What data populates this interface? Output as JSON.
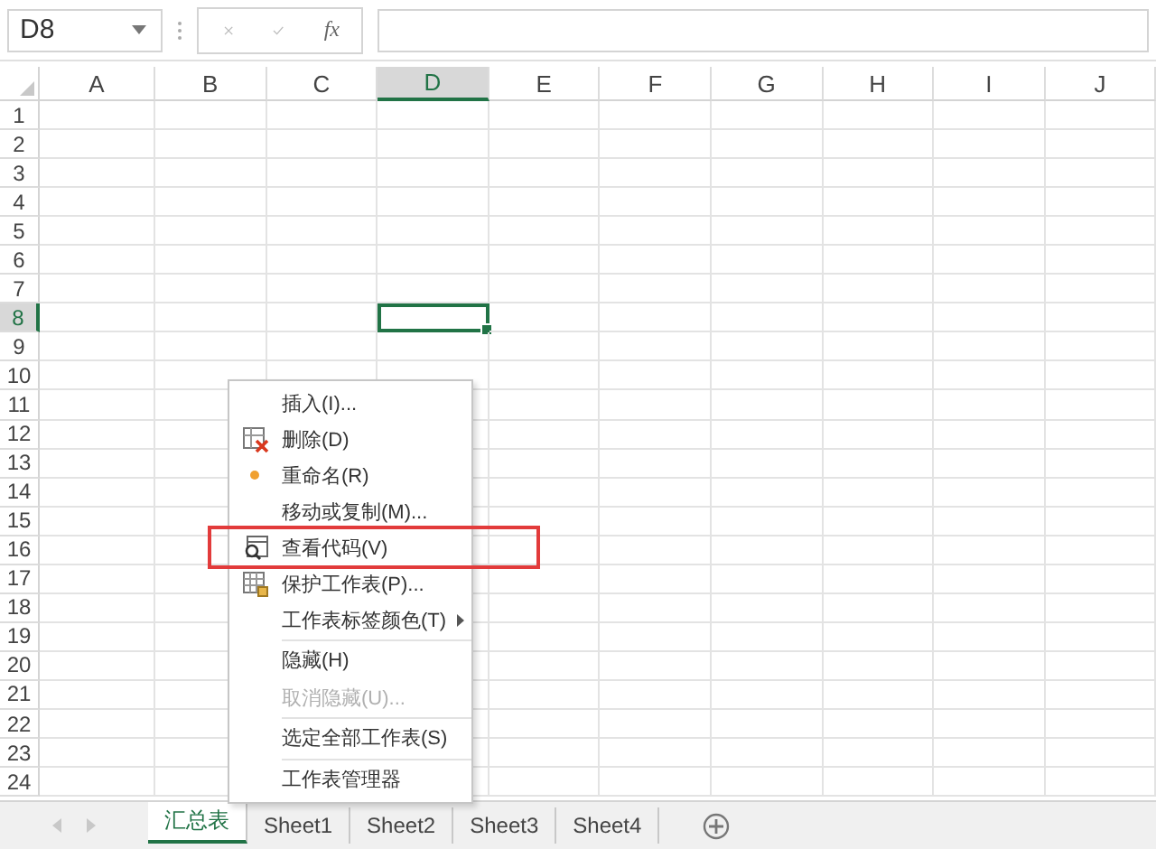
{
  "name_box": {
    "value": "D8"
  },
  "formula_bar": {
    "function_label": "fx"
  },
  "columns": [
    {
      "label": "A",
      "selected": false
    },
    {
      "label": "B",
      "selected": false
    },
    {
      "label": "C",
      "selected": false
    },
    {
      "label": "D",
      "selected": true
    },
    {
      "label": "E",
      "selected": false
    },
    {
      "label": "F",
      "selected": false
    },
    {
      "label": "G",
      "selected": false
    },
    {
      "label": "H",
      "selected": false
    },
    {
      "label": "I",
      "selected": false
    },
    {
      "label": "J",
      "selected": false
    }
  ],
  "rows": [
    {
      "label": "1",
      "selected": false
    },
    {
      "label": "2",
      "selected": false
    },
    {
      "label": "3",
      "selected": false
    },
    {
      "label": "4",
      "selected": false
    },
    {
      "label": "5",
      "selected": false
    },
    {
      "label": "6",
      "selected": false
    },
    {
      "label": "7",
      "selected": false
    },
    {
      "label": "8",
      "selected": true
    },
    {
      "label": "9",
      "selected": false
    },
    {
      "label": "10",
      "selected": false
    },
    {
      "label": "11",
      "selected": false
    },
    {
      "label": "12",
      "selected": false
    },
    {
      "label": "13",
      "selected": false
    },
    {
      "label": "14",
      "selected": false
    },
    {
      "label": "15",
      "selected": false
    },
    {
      "label": "16",
      "selected": false
    },
    {
      "label": "17",
      "selected": false
    },
    {
      "label": "18",
      "selected": false
    },
    {
      "label": "19",
      "selected": false
    },
    {
      "label": "20",
      "selected": false
    },
    {
      "label": "21",
      "selected": false
    },
    {
      "label": "22",
      "selected": false
    },
    {
      "label": "23",
      "selected": false
    },
    {
      "label": "24",
      "selected": false
    }
  ],
  "sheet_tabs": [
    {
      "label": "汇总表",
      "selected": true
    },
    {
      "label": "Sheet1",
      "selected": false
    },
    {
      "label": "Sheet2",
      "selected": false
    },
    {
      "label": "Sheet3",
      "selected": false
    },
    {
      "label": "Sheet4",
      "selected": false
    }
  ],
  "context_menu": {
    "items": [
      {
        "label": "插入(I)...",
        "kind": "plain",
        "disabled": false,
        "submenu": false,
        "highlighted": false,
        "separator_before": false
      },
      {
        "label": "删除(D)",
        "kind": "delete",
        "disabled": false,
        "submenu": false,
        "highlighted": false,
        "separator_before": false
      },
      {
        "label": "重命名(R)",
        "kind": "dot",
        "disabled": false,
        "submenu": false,
        "highlighted": false,
        "separator_before": false
      },
      {
        "label": "移动或复制(M)...",
        "kind": "plain",
        "disabled": false,
        "submenu": false,
        "highlighted": false,
        "separator_before": false
      },
      {
        "label": "查看代码(V)",
        "kind": "code",
        "disabled": false,
        "submenu": false,
        "highlighted": true,
        "separator_before": false
      },
      {
        "label": "保护工作表(P)...",
        "kind": "protect",
        "disabled": false,
        "submenu": false,
        "highlighted": false,
        "separator_before": false
      },
      {
        "label": "工作表标签颜色(T)",
        "kind": "plain",
        "disabled": false,
        "submenu": true,
        "highlighted": false,
        "separator_before": false
      },
      {
        "label": "隐藏(H)",
        "kind": "plain",
        "disabled": false,
        "submenu": false,
        "highlighted": false,
        "separator_before": true
      },
      {
        "label": "取消隐藏(U)...",
        "kind": "plain",
        "disabled": true,
        "submenu": false,
        "highlighted": false,
        "separator_before": false
      },
      {
        "label": "选定全部工作表(S)",
        "kind": "plain",
        "disabled": false,
        "submenu": false,
        "highlighted": false,
        "separator_before": true
      },
      {
        "label": "工作表管理器",
        "kind": "plain",
        "disabled": false,
        "submenu": false,
        "highlighted": false,
        "separator_before": true
      }
    ]
  }
}
